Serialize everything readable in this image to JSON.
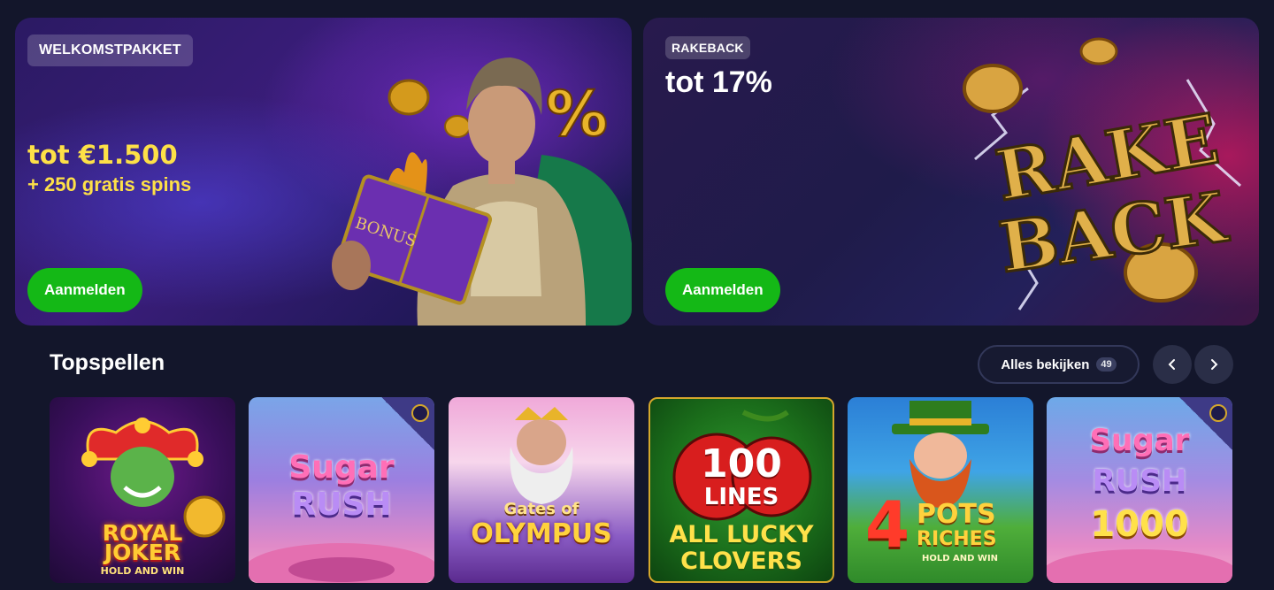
{
  "banners": {
    "welcome": {
      "badge": "WELKOMSTPAKKET",
      "amount": "tot €1.500",
      "spins": "+ 250 gratis spins",
      "book_text": "BONUS",
      "cta": "Aanmelden"
    },
    "rakeback": {
      "badge": "RAKEBACK",
      "title": "tot 17%",
      "art_line1": "RAKE",
      "art_line2": "BACK",
      "cta": "Aanmelden"
    }
  },
  "top_games": {
    "title": "Topspellen",
    "view_all_label": "Alles bekijken",
    "view_all_count": "49",
    "prev_icon": "chevron-left-icon",
    "next_icon": "chevron-right-icon",
    "games": [
      {
        "line1": "ROYAL",
        "line2": "JOKER",
        "line3": "HOLD AND WIN"
      },
      {
        "line1": "Sugar",
        "line2": "RUSH"
      },
      {
        "line1": "Gates of",
        "line2": "OLYMPUS"
      },
      {
        "line1": "100",
        "line2": "LINES",
        "line3": "ALL LUCKY",
        "line4": "CLOVERS"
      },
      {
        "line1": "4",
        "line2": "POTS",
        "line3": "RICHES",
        "line4": "HOLD AND WIN"
      },
      {
        "line1": "Sugar",
        "line2": "RUSH",
        "line3": "1000"
      }
    ]
  },
  "colors": {
    "background": "#13162b",
    "cta_green": "#14b816",
    "promo_yellow": "#fde047"
  }
}
